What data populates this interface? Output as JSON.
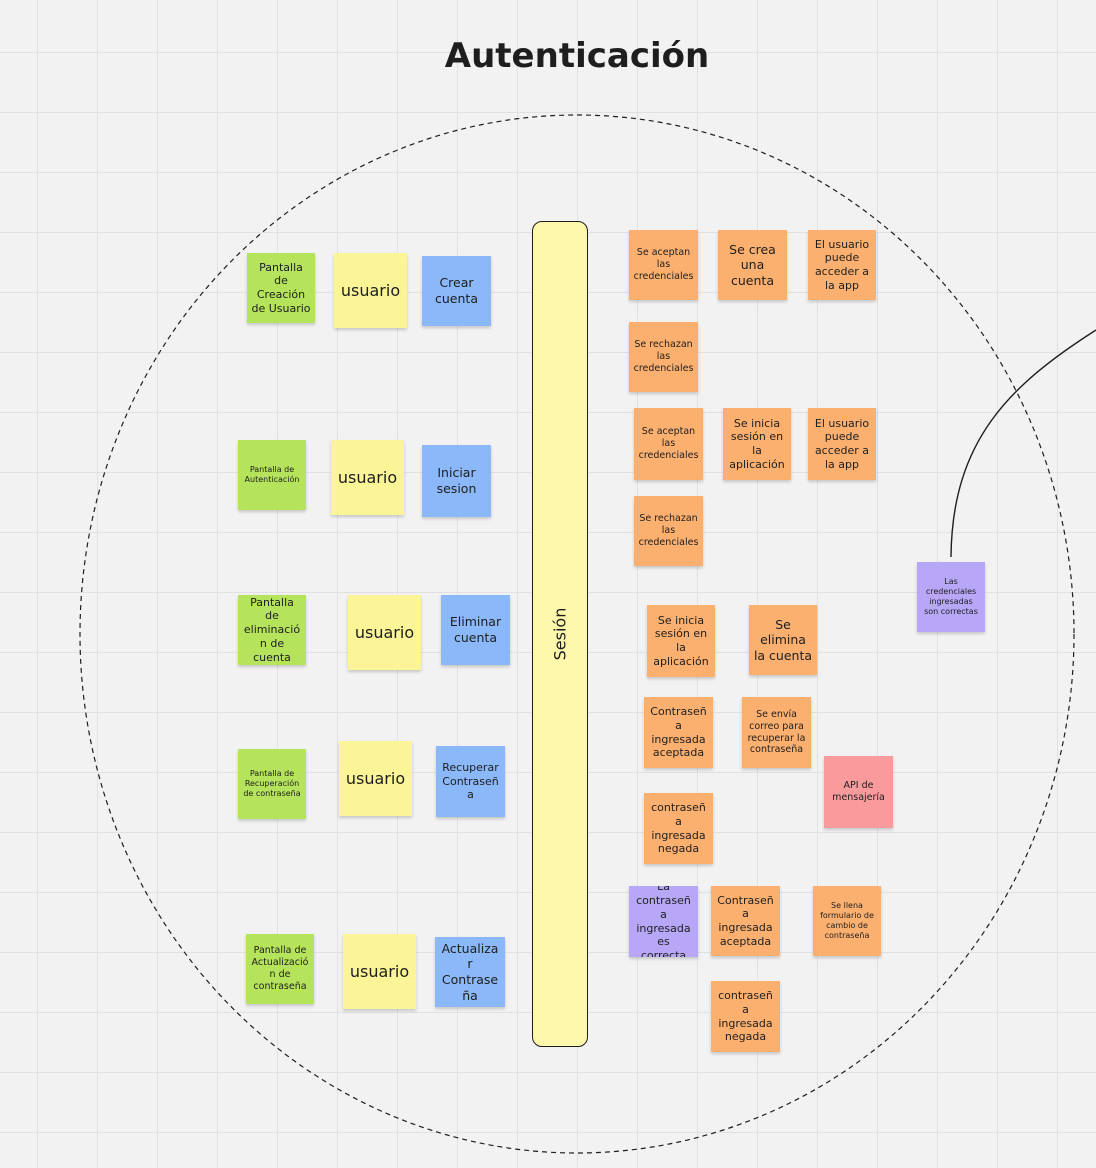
{
  "board": {
    "title": "Autenticación",
    "session_label": "Sesión"
  },
  "actor_notes": {
    "screen_create_user": "Pantalla de Creación de Usuario",
    "screen_authentication": "Pantalla de Autenticación",
    "screen_delete_account": "Pantalla de eliminación de cuenta",
    "screen_recover_password": "Pantalla de Recuperación de contraseña",
    "screen_update_password": "Pantalla de Actualización de contraseña",
    "user_1": "usuario",
    "user_2": "usuario",
    "user_3": "usuario",
    "user_4": "usuario",
    "user_5": "usuario",
    "cmd_create_account": "Crear cuenta",
    "cmd_login": "Iniciar sesion",
    "cmd_delete_account": "Eliminar cuenta",
    "cmd_recover_password": "Recuperar Contraseña",
    "cmd_update_password": "Actualizar Contraseña"
  },
  "event_notes": {
    "creds_accepted_1": "Se aceptan las credenciales",
    "account_created": "Se crea una cuenta",
    "user_access_1": "El usuario puede acceder a la app",
    "creds_rejected_1": "Se rechazan las credenciales",
    "creds_accepted_2": "Se aceptan las credenciales",
    "session_started_1": "Se inicia sesión en la aplicación",
    "user_access_2": "El usuario puede acceder a la app",
    "creds_rejected_2": "Se rechazan las credenciales",
    "session_started_2": "Se inicia sesión en la aplicación",
    "account_deleted": "Se elimina la cuenta",
    "password_accepted_1": "Contraseña ingresada aceptada",
    "recovery_email_sent": "Se envía correo para recuperar la contraseña",
    "password_denied_1": "contraseña ingresada negada",
    "password_accepted_2": "Contraseña ingresada aceptada",
    "change_form_filled": "Se llena formulario de cambio de contraseña",
    "password_denied_2": "contraseña ingresada negada"
  },
  "other_notes": {
    "messaging_api": "API de mensajería",
    "rule_credentials_correct": "Las credenciales ingresadas son correctas",
    "rule_password_correct": "La contraseña ingresada es correcta"
  },
  "colors": {
    "green": "#b5e45c",
    "yellow": "#fbf598",
    "blue": "#8ab8f8",
    "orange": "#fbb070",
    "purple": "#b8a6f6",
    "pink": "#f99b9d",
    "session_bar": "#fdf8ab"
  }
}
